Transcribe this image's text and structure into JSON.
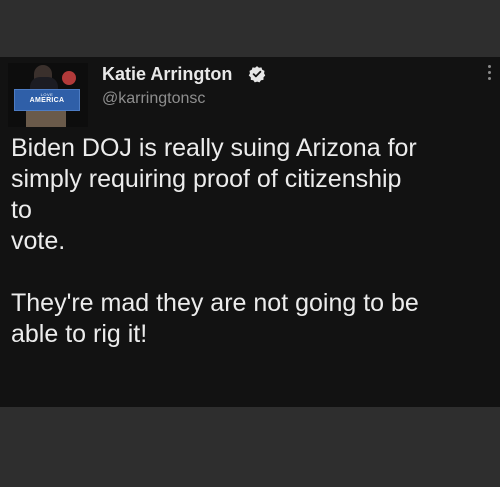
{
  "tweet": {
    "author_name": "Katie Arrington",
    "handle": "@karringtonsc",
    "avatar_sign": {
      "small_text": "LOVE",
      "main_text": "AMERICA",
      "color": "#2f5fa8"
    },
    "verified_icon": "verified-badge-icon",
    "more_icon": "vertical-ellipsis-icon",
    "body": "Biden DOJ is really suing Arizona for\nsimply requiring proof of citizenship\nto\nvote.\n\nThey're mad they are not going to be\nable to rig it!"
  },
  "colors": {
    "card_background": "#121212",
    "outer_background": "#2e2e2e",
    "text_primary": "#ececec",
    "text_secondary": "#8e8e8e"
  }
}
